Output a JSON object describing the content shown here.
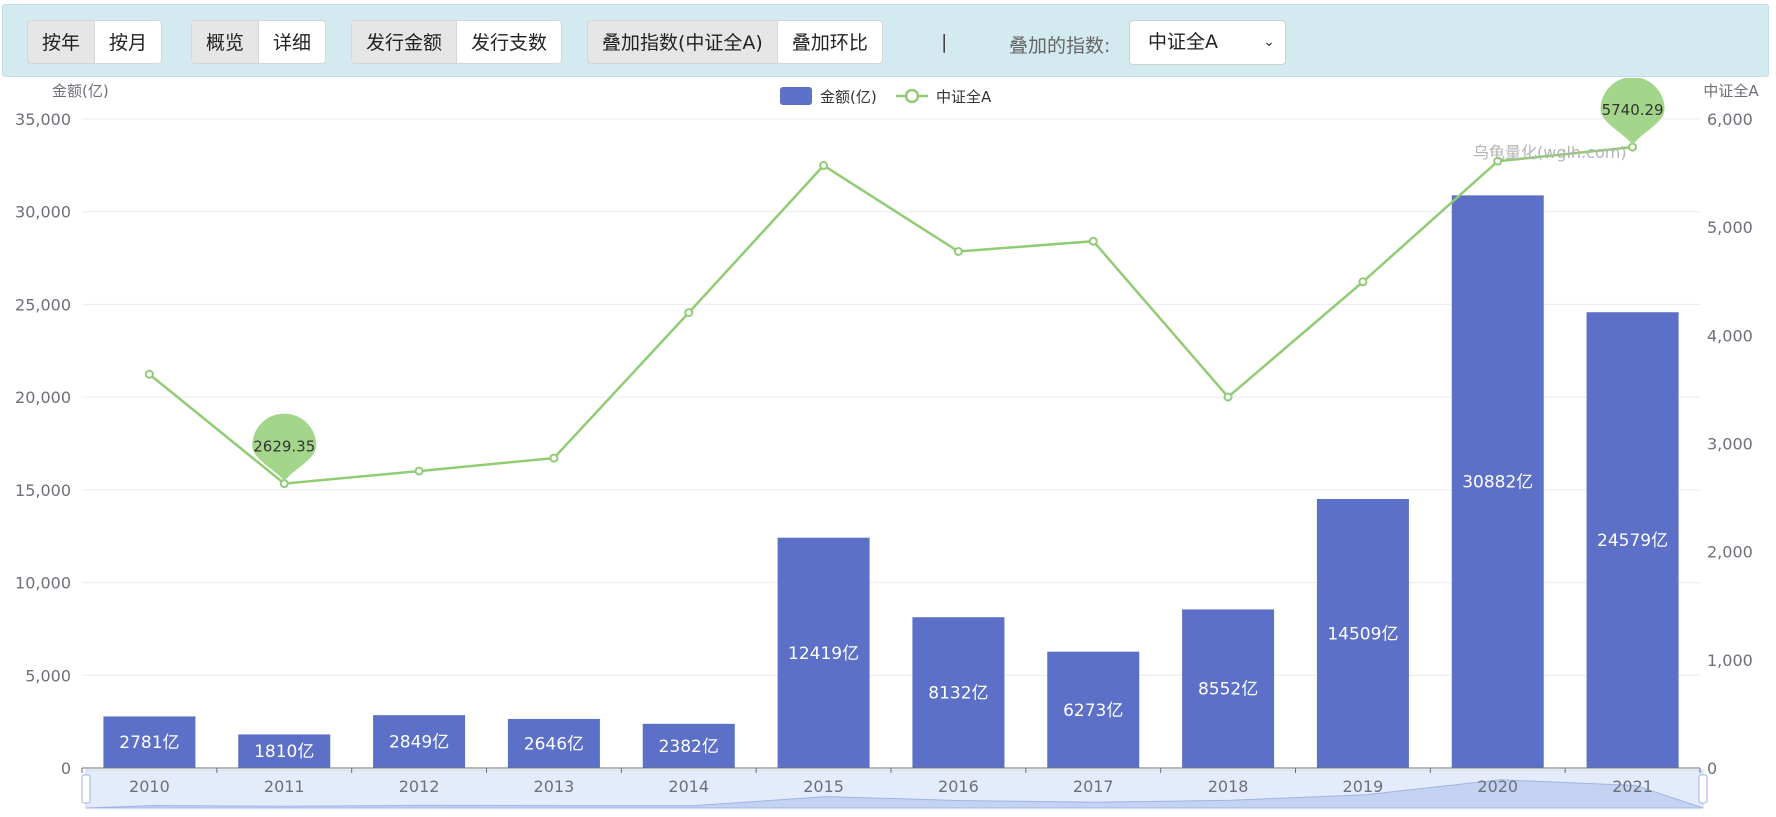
{
  "toolbar": {
    "period": [
      "按年",
      "按月"
    ],
    "view": [
      "概览",
      "详细"
    ],
    "metric": [
      "发行金额",
      "发行支数"
    ],
    "overlay": [
      "叠加指数(中证全A)",
      "叠加环比"
    ],
    "separator": "|",
    "index_label": "叠加的指数:",
    "index_selected": "中证全A"
  },
  "watermark": "乌龟量化(wglh.com)",
  "chart_data": {
    "type": "bar",
    "categories": [
      "2010",
      "2011",
      "2012",
      "2013",
      "2014",
      "2015",
      "2016",
      "2017",
      "2018",
      "2019",
      "2020",
      "2021"
    ],
    "series": [
      {
        "name": "金额(亿)",
        "type": "bar",
        "axis": "left",
        "values": [
          2781,
          1810,
          2849,
          2646,
          2382,
          12419,
          8132,
          6273,
          8552,
          14509,
          30882,
          24579
        ],
        "labels": [
          "2781亿",
          "1810亿",
          "2849亿",
          "2646亿",
          "2382亿",
          "12419亿",
          "8132亿",
          "6273亿",
          "8552亿",
          "14509亿",
          "30882亿",
          "24579亿"
        ]
      },
      {
        "name": "中证全A",
        "type": "line",
        "axis": "right",
        "values": [
          3640,
          2629.35,
          2745,
          2865,
          4210,
          5570,
          4775,
          4870,
          3430,
          4495,
          5610,
          5740.29
        ]
      }
    ],
    "ylabel": "金额(亿)",
    "y2label": "中证全A",
    "ylim": [
      0,
      35000
    ],
    "y2lim": [
      0,
      6000
    ],
    "yticks": [
      "0",
      "5,000",
      "10,000",
      "15,000",
      "20,000",
      "25,000",
      "30,000",
      "35,000"
    ],
    "y2ticks": [
      "0",
      "1,000",
      "2,000",
      "3,000",
      "4,000",
      "5,000",
      "6,000"
    ],
    "markers": [
      {
        "index": 1,
        "label": "2629.35"
      },
      {
        "index": 11,
        "label": "5740.29"
      }
    ],
    "legend_position": "top-center",
    "grid": true,
    "colors": {
      "bar": "#5b70c6",
      "line": "#91cc75",
      "grid": "#e8ecf3",
      "axis": "#6e7079"
    }
  }
}
